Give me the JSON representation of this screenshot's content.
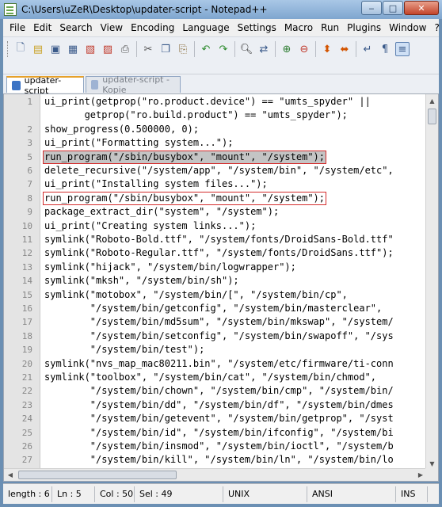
{
  "window": {
    "title": "C:\\Users\\uZeR\\Desktop\\updater-script - Notepad++"
  },
  "menu": [
    "File",
    "Edit",
    "Search",
    "View",
    "Encoding",
    "Language",
    "Settings",
    "Macro",
    "Run",
    "Plugins",
    "Window",
    "?"
  ],
  "toolbar": [
    "new-file-icon",
    "open-file-icon",
    "save-icon",
    "save-all-icon",
    "close-icon",
    "close-all-icon",
    "print-icon",
    "cut-icon",
    "copy-icon",
    "paste-icon",
    "undo-icon",
    "redo-icon",
    "find-icon",
    "replace-icon",
    "zoom-in-icon",
    "zoom-out-icon",
    "sync-vertical-icon",
    "sync-horizontal-icon",
    "word-wrap-icon",
    "show-all-characters-icon",
    "indent-guide-icon"
  ],
  "tabs": [
    {
      "label": "updater-script",
      "active": true
    },
    {
      "label": "updater-script - Kopie",
      "active": false
    }
  ],
  "editor": {
    "lines": [
      {
        "n": "1",
        "text": "ui_print(getprop(\"ro.product.device\") == \"umts_spyder\" ||"
      },
      {
        "n": "",
        "text": "       getprop(\"ro.build.product\") == \"umts_spyder\");"
      },
      {
        "n": "2",
        "text": "show_progress(0.500000, 0);"
      },
      {
        "n": "3",
        "text": "ui_print(\"Formatting system...\");"
      },
      {
        "n": "5",
        "text": "run_program(\"/sbin/busybox\", \"mount\", \"/system\");"
      },
      {
        "n": "6",
        "text": "delete_recursive(\"/system/app\", \"/system/bin\", \"/system/etc\","
      },
      {
        "n": "7",
        "text": "ui_print(\"Installing system files...\");"
      },
      {
        "n": "8",
        "text": "run_program(\"/sbin/busybox\", \"mount\", \"/system\");"
      },
      {
        "n": "9",
        "text": "package_extract_dir(\"system\", \"/system\");"
      },
      {
        "n": "10",
        "text": "ui_print(\"Creating system links...\");"
      },
      {
        "n": "11",
        "text": "symlink(\"Roboto-Bold.ttf\", \"/system/fonts/DroidSans-Bold.ttf\""
      },
      {
        "n": "12",
        "text": "symlink(\"Roboto-Regular.ttf\", \"/system/fonts/DroidSans.ttf\");"
      },
      {
        "n": "13",
        "text": "symlink(\"hijack\", \"/system/bin/logwrapper\");"
      },
      {
        "n": "14",
        "text": "symlink(\"mksh\", \"/system/bin/sh\");"
      },
      {
        "n": "15",
        "text": "symlink(\"motobox\", \"/system/bin/[\", \"/system/bin/cp\","
      },
      {
        "n": "16",
        "text": "        \"/system/bin/getconfig\", \"/system/bin/masterclear\","
      },
      {
        "n": "17",
        "text": "        \"/system/bin/md5sum\", \"/system/bin/mkswap\", \"/system/"
      },
      {
        "n": "18",
        "text": "        \"/system/bin/setconfig\", \"/system/bin/swapoff\", \"/sys"
      },
      {
        "n": "19",
        "text": "        \"/system/bin/test\");"
      },
      {
        "n": "20",
        "text": "symlink(\"nvs_map_mac80211.bin\", \"/system/etc/firmware/ti-conn"
      },
      {
        "n": "21",
        "text": "symlink(\"toolbox\", \"/system/bin/cat\", \"/system/bin/chmod\","
      },
      {
        "n": "22",
        "text": "        \"/system/bin/chown\", \"/system/bin/cmp\", \"/system/bin/"
      },
      {
        "n": "23",
        "text": "        \"/system/bin/dd\", \"/system/bin/df\", \"/system/bin/dmes"
      },
      {
        "n": "24",
        "text": "        \"/system/bin/getevent\", \"/system/bin/getprop\", \"/syst"
      },
      {
        "n": "25",
        "text": "        \"/system/bin/id\", \"/system/bin/ifconfig\", \"/system/bi"
      },
      {
        "n": "26",
        "text": "        \"/system/bin/insmod\", \"/system/bin/ioctl\", \"/system/b"
      },
      {
        "n": "27",
        "text": "        \"/system/bin/kill\", \"/system/bin/ln\", \"/system/bin/lo"
      }
    ]
  },
  "status": {
    "length": "length : 6",
    "ln": "Ln : 5",
    "col": "Col : 50",
    "sel": "Sel : 49",
    "eol": "UNIX",
    "encoding": "ANSI",
    "mode": "INS"
  }
}
